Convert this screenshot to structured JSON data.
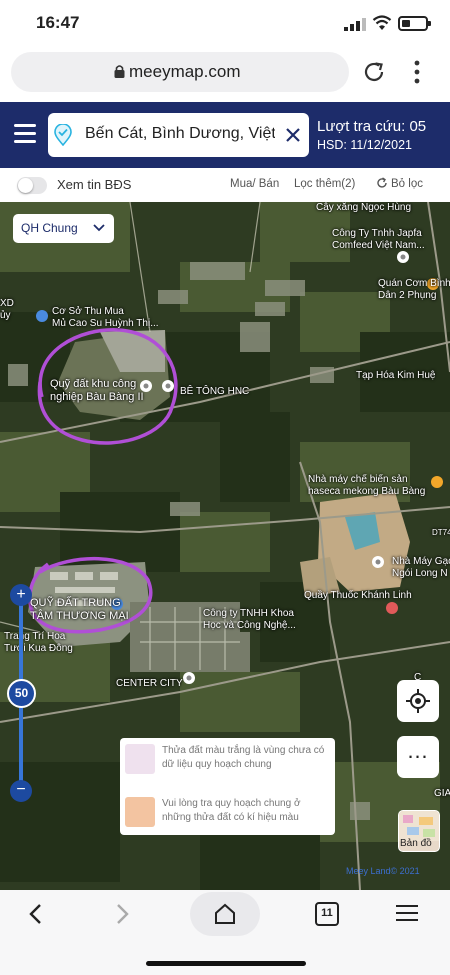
{
  "status_bar": {
    "time": "16:47"
  },
  "browser": {
    "url": "meeymap.com",
    "tab_count": "11"
  },
  "header": {
    "search_value": "Bến Cát, Bình Dương, Việt",
    "quota_label": "Lượt tra cứu: 05",
    "expiry_label": "HSD: 11/12/2021"
  },
  "filters": {
    "toggle_label": "Xem tin BĐS",
    "transaction": "Mua/ Bán",
    "more_filters": "Lọc thêm(2)",
    "reset": "Bỏ lọc"
  },
  "map": {
    "layer_select": "QH Chung",
    "zoom_level": "50",
    "labels": {
      "cay_xang": "Cây xăng Ngọc Hùng",
      "japfa": "Công Ty Tnhh Japfa\nComfeed Việt Nam...",
      "quan_com": "Quán Cơm Bình\nDân 2 Phụng",
      "co_so": "Cơ Sở Thu Mua\nMủ Cao Su Huỳnh Thị...",
      "xd": "XD\nủy",
      "quy_dat_kcn": "Quỹ đất khu công\nnghiệp Bàu Bàng II",
      "be_tong": "BÊ TÔNG HNC",
      "tap_hoa": "Tạp Hóa Kim Huệ",
      "nha_may_che_bien": "Nhà máy chế biến sản\nhaseca mekong Bàu Bàng",
      "dt7": "DT74",
      "nha_may_gach": "Nhà Máy Gạc\nNgói Long N",
      "quy_dat_ttm": "QUỸ ĐẤT TRUNG\nTÂM THƯƠNG MẠI",
      "quay_thuoc": "Quầy Thuốc Khánh Linh",
      "khoa_hoc": "Công ty TNHH Khoa\nHọc và Công Nghệ...",
      "trang_tri": "Trang Trí Hoa\nTươi Kua Đông",
      "center_city": "CENTER CITY",
      "right_th": "C\nV Th",
      "gia": "GIA"
    },
    "legend": {
      "white_parcels": "Thửa đất màu trắng là vùng chưa có dữ liệu quy hoạch chung",
      "marked_parcels": "Vui lòng tra quy hoạch chung ở những thửa đất có kí hiệu màu"
    },
    "basemap_label": "Bản đồ",
    "copyright": "Meey Land© 2021"
  },
  "colors": {
    "brand_navy": "#1d2c6a",
    "zoom_blue": "#1d4aa0",
    "annotation_purple": "#b04fd6"
  }
}
